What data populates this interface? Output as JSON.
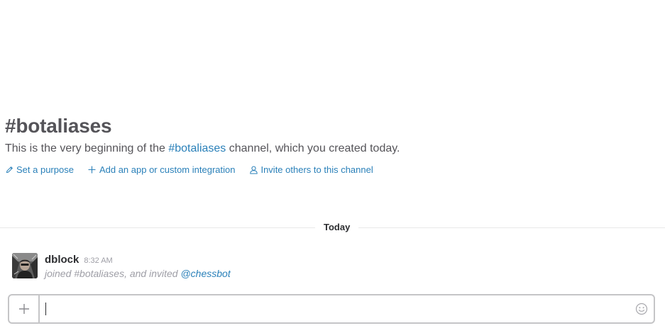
{
  "channel": {
    "title": "#botaliases",
    "intro_prefix": "This is the very beginning of the ",
    "intro_link": "#botaliases",
    "intro_suffix": " channel, which you created today."
  },
  "actions": [
    {
      "label": "Set a purpose",
      "icon": "pencil-icon"
    },
    {
      "label": "Add an app or custom integration",
      "icon": "plus-icon"
    },
    {
      "label": "Invite others to this channel",
      "icon": "user-icon"
    }
  ],
  "divider": {
    "label": "Today"
  },
  "message": {
    "username": "dblock",
    "timestamp": "8:32 AM",
    "text_prefix": "joined #botaliases, and invited ",
    "mention": "@chessbot"
  },
  "composer": {
    "value": "",
    "plus_icon": "plus-icon",
    "emoji_icon": "emoji-icon"
  },
  "colors": {
    "link": "#2a80b9",
    "muted": "#9e9ea6",
    "title": "#555459"
  }
}
